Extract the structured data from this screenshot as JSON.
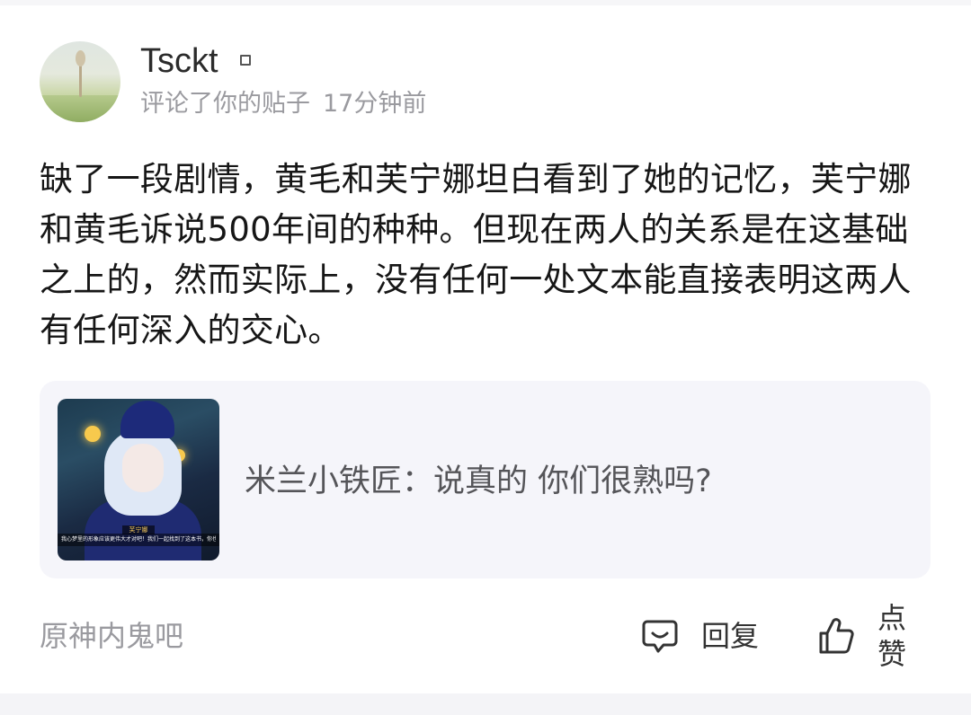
{
  "post": {
    "author": {
      "name": "Tsckt",
      "badge_icon": "badge-square-icon"
    },
    "meta": {
      "action": "评论了你的贴子",
      "time": "17分钟前"
    },
    "body": "缺了一段剧情，黄毛和芙宁娜坦白看到了她的记忆，芙宁娜和黄毛诉说500年间的种种。但现在两人的关系是在这基础之上的，然而实际上，没有任何一处文本能直接表明这两人有任何深入的交心。",
    "quote": {
      "text": "米兰小铁匠：说真的 你们很熟吗?",
      "thumbnail": {
        "subtitle_name": "芙宁娜",
        "subtitle_line": "我心梦里的形象应该更伟大才对吧！我们一起找到了这本书，你也记住了"
      }
    },
    "footer": {
      "forum": "原神内鬼吧",
      "reply_label": "回复",
      "like_label": "点赞"
    }
  },
  "colors": {
    "meta_text": "#9a9a9f",
    "card_bg": "#f5f5fa"
  }
}
